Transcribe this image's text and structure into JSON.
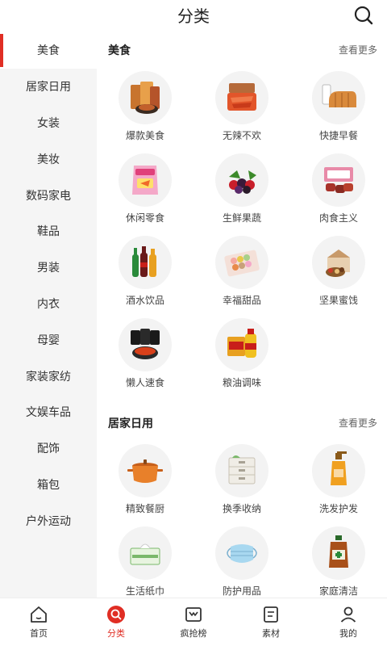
{
  "header": {
    "title": "分类"
  },
  "sidebar": {
    "items": [
      {
        "label": "美食",
        "active": true
      },
      {
        "label": "居家日用"
      },
      {
        "label": "女装"
      },
      {
        "label": "美妆"
      },
      {
        "label": "数码家电"
      },
      {
        "label": "鞋品"
      },
      {
        "label": "男装"
      },
      {
        "label": "内衣"
      },
      {
        "label": "母婴"
      },
      {
        "label": "家装家纺"
      },
      {
        "label": "文娱车品"
      },
      {
        "label": "配饰"
      },
      {
        "label": "箱包"
      },
      {
        "label": "户外运动"
      }
    ]
  },
  "sections": [
    {
      "title": "美食",
      "more": "查看更多",
      "items": [
        {
          "label": "爆款美食",
          "icon": "packaged-food-icon"
        },
        {
          "label": "无辣不欢",
          "icon": "spicy-meat-icon"
        },
        {
          "label": "快捷早餐",
          "icon": "bread-milk-icon"
        },
        {
          "label": "休闲零食",
          "icon": "snack-bag-icon"
        },
        {
          "label": "生鲜果蔬",
          "icon": "berries-icon"
        },
        {
          "label": "肉食主义",
          "icon": "meat-box-icon"
        },
        {
          "label": "酒水饮品",
          "icon": "bottles-icon"
        },
        {
          "label": "幸福甜品",
          "icon": "macaron-icon"
        },
        {
          "label": "坚果蜜饯",
          "icon": "nuts-box-icon"
        },
        {
          "label": "懒人速食",
          "icon": "instant-noodles-icon"
        },
        {
          "label": "粮油调味",
          "icon": "oil-bottle-icon"
        }
      ]
    },
    {
      "title": "居家日用",
      "more": "查看更多",
      "items": [
        {
          "label": "精致餐厨",
          "icon": "pot-icon"
        },
        {
          "label": "换季收纳",
          "icon": "storage-drawer-icon"
        },
        {
          "label": "洗发护发",
          "icon": "shampoo-icon"
        },
        {
          "label": "生活纸巾",
          "icon": "tissue-box-icon"
        },
        {
          "label": "防护用品",
          "icon": "face-mask-icon"
        },
        {
          "label": "家庭清洁",
          "icon": "disinfectant-icon"
        }
      ]
    }
  ],
  "tabbar": {
    "items": [
      {
        "label": "首页",
        "icon": "home-icon"
      },
      {
        "label": "分类",
        "icon": "search-icon",
        "active": true
      },
      {
        "label": "疯抢榜",
        "icon": "ranking-icon"
      },
      {
        "label": "素材",
        "icon": "document-icon"
      },
      {
        "label": "我的",
        "icon": "user-icon"
      }
    ]
  },
  "colors": {
    "accent": "#e02e24",
    "sidebar_bg": "#f5f5f5"
  }
}
